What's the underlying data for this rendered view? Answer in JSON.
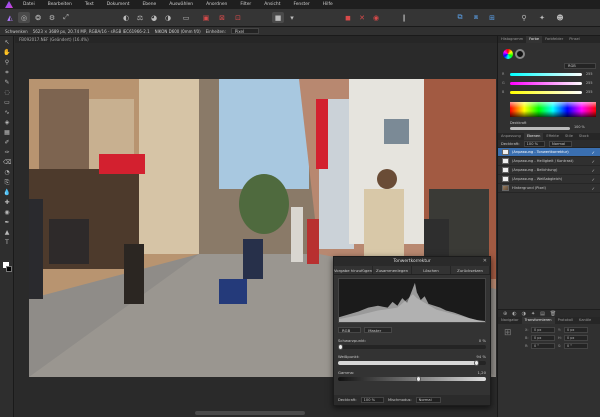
{
  "menu": [
    "Datei",
    "Bearbeiten",
    "Text",
    "Dokument",
    "Ebene",
    "Auswählen",
    "Anordnen",
    "Filter",
    "Ansicht",
    "Fenster",
    "Hilfe"
  ],
  "context": {
    "tool": "Schwenken",
    "info": "5623 × 3689 px, 20.74 MP, RGBA/16 - sRGB IEC61966-2.1",
    "camera": "NIKON D600 (0mm f/0)",
    "units_label": "Einheiten:",
    "units_value": "Pixel"
  },
  "document": {
    "tab_title": "FB092017.NEF (Geändert) (16.4%)"
  },
  "dialog": {
    "title": "Tonwertkorrektur",
    "buttons": [
      "Vorgabe hinzufügen",
      "Zusammenlegen",
      "Löschen",
      "Zurücksetzen"
    ],
    "channel": "RGB",
    "mode": "Master",
    "black_label": "Schwarzpunkt:",
    "black_value": "0 %",
    "white_label": "Weißpunkt:",
    "white_value": "94 %",
    "gamma_label": "Gamma:",
    "gamma_value": "1,20",
    "white_fraction": 0.94,
    "gamma_knob_fraction": 0.55,
    "opacity_label": "Deckkraft:",
    "opacity_value": "100 %",
    "blend_label": "Mischmodus:",
    "blend_value": "Normal"
  },
  "right_panel": {
    "color_tabs": [
      "Histogramm",
      "Farbe",
      "Farbfelder",
      "Pinsel"
    ],
    "color_mode": "RGB",
    "slider_labels": [
      "R",
      "G",
      "B"
    ],
    "slider_values": [
      "255",
      "255",
      "255"
    ],
    "opacity_label": "Deckkraft",
    "opacity_value": "100 %",
    "layer_tabs": [
      "Anpassung",
      "Ebenen",
      "Effekte",
      "Stile",
      "Stock"
    ],
    "layer_opacity_label": "Deckkraft:",
    "layer_opacity_value": "100 %",
    "layer_blend": "Normal",
    "layers": [
      {
        "name": "(Anpassung - Tonwertkorrektur)",
        "selected": true
      },
      {
        "name": "(Anpassung - Helligkeit / Kontrast)",
        "selected": false
      },
      {
        "name": "(Anpassung - Belichtung)",
        "selected": false
      },
      {
        "name": "(Anpassung - Weißabgleich)",
        "selected": false
      },
      {
        "name": "Hintergrund (Pixel)",
        "selected": false
      }
    ],
    "nav_tabs": [
      "Navigator",
      "Transformieren",
      "Protokoll",
      "Kanäle"
    ],
    "transform_labels": [
      "X:",
      "Y:",
      "B:",
      "H:",
      "R:",
      "S:"
    ],
    "transform_values": [
      "0 px",
      "0 px",
      "0 px",
      "0 px",
      "0 °",
      "0 °"
    ]
  },
  "colors": {
    "accent": "#3a6fb0",
    "shop_sign": "#d3202f",
    "sky": "#a8c8e0"
  },
  "icons": [
    "affinity-logo",
    "persona-photo",
    "persona-liquify",
    "persona-develop",
    "persona-tonemapping",
    "persona-export"
  ]
}
